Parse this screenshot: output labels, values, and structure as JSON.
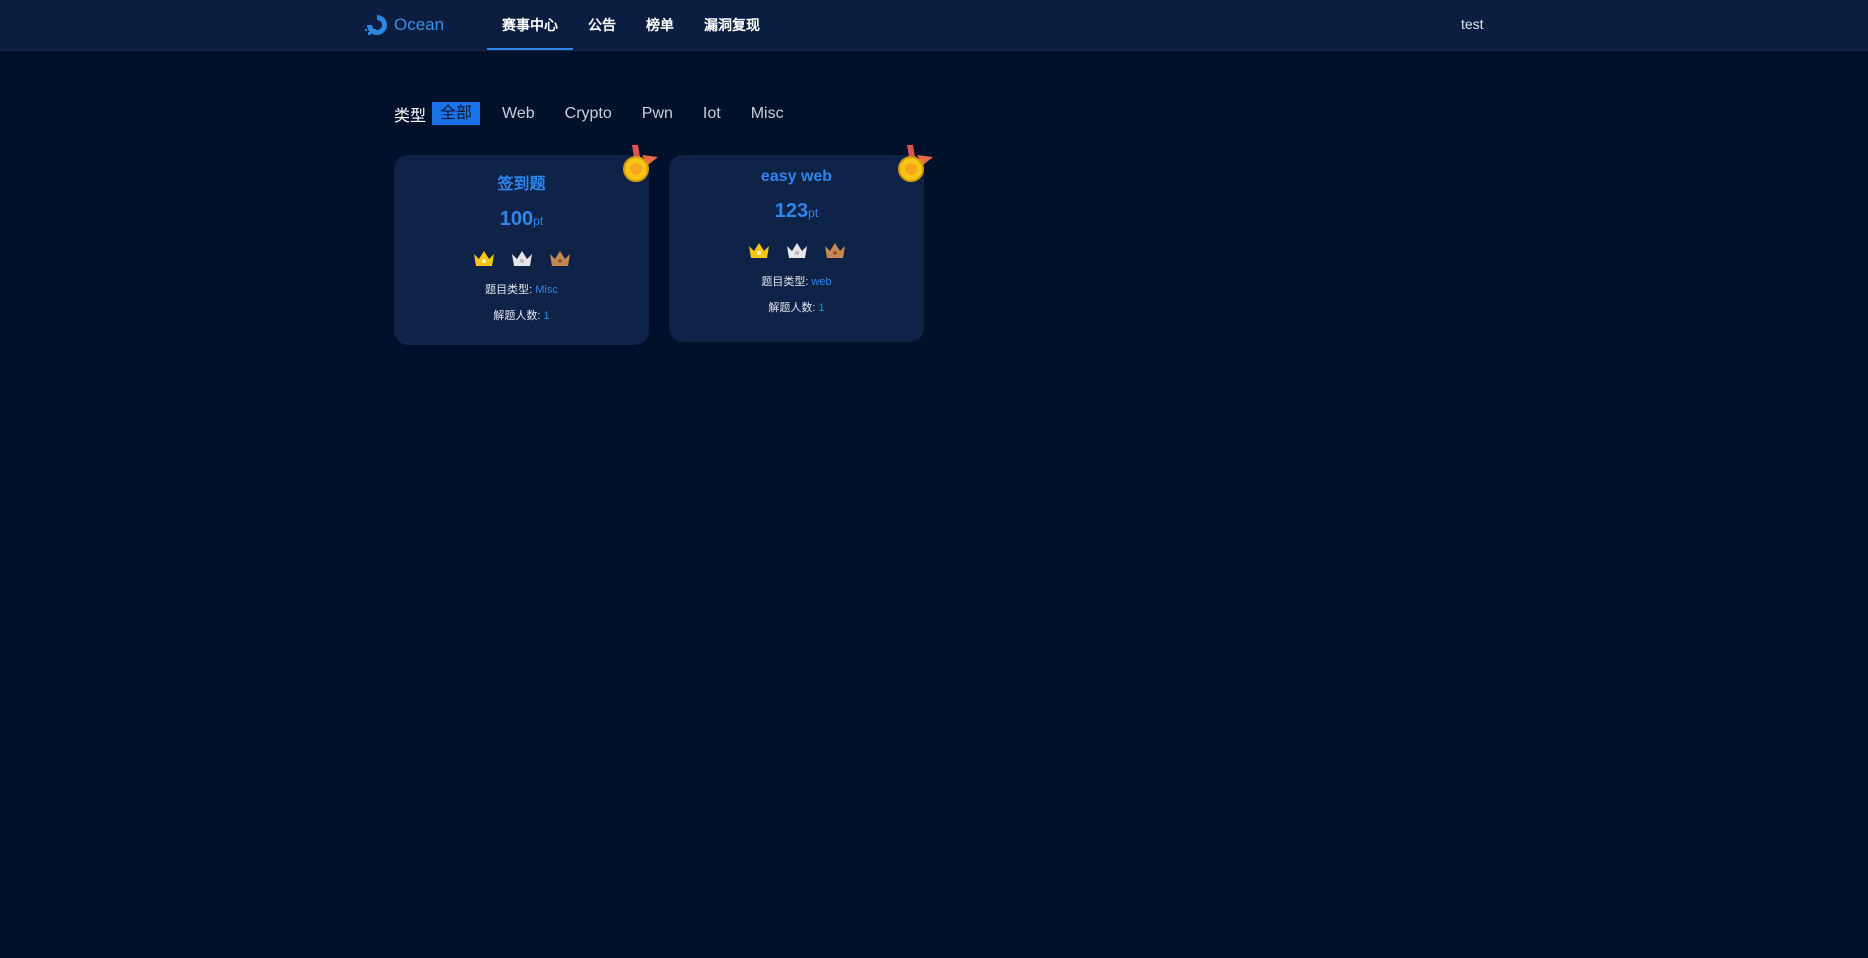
{
  "nav": {
    "brand": "Ocean",
    "items": [
      {
        "label": "赛事中心",
        "active": true
      },
      {
        "label": "公告"
      },
      {
        "label": "榜单"
      },
      {
        "label": "漏洞复现"
      }
    ],
    "user": "test"
  },
  "filter": {
    "label": "类型",
    "options": [
      "全部",
      "Web",
      "Crypto",
      "Pwn",
      "Iot",
      "Misc"
    ]
  },
  "cards": [
    {
      "title": "签到题",
      "score": "100",
      "unit": "pt",
      "type_label": "题目类型:",
      "type": "Misc",
      "solves_label": "解题人数:",
      "solves": "1"
    },
    {
      "title": "easy web",
      "score": "123",
      "unit": "pt",
      "type_label": "题目类型:",
      "type": "web",
      "solves_label": "解题人数:",
      "solves": "1"
    }
  ],
  "colors": {
    "accent": "#2e86ec",
    "gold": "#f5c518",
    "silver": "#e6e6e6",
    "bronze": "#c98a52"
  }
}
